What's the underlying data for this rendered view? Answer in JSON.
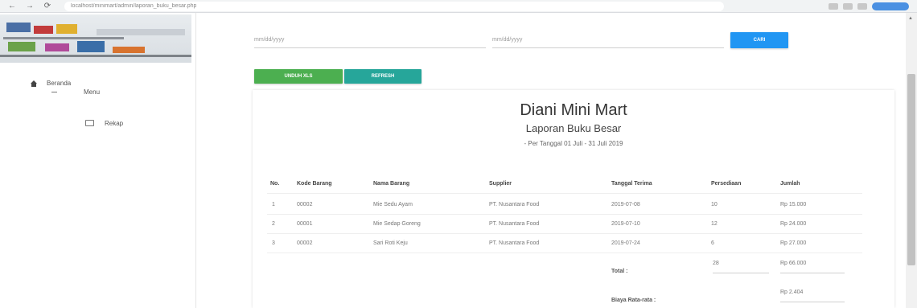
{
  "browser": {
    "back": "←",
    "forward": "→",
    "reload": "⟳",
    "url": "localhost/minimart/admin/laporan_buku_besar.php"
  },
  "sidebar": {
    "home_label": "Beranda",
    "menu_label": "Menu",
    "sub_label": "Rekap"
  },
  "filters": {
    "start_placeholder": "mm/dd/yyyy",
    "end_placeholder": "mm/dd/yyyy",
    "search_label": "CARI",
    "download_label": "UNDUH XLS",
    "refresh_label": "REFRESH"
  },
  "report": {
    "store_name": "Diani Mini Mart",
    "title": "Laporan Buku Besar",
    "period": "- Per Tanggal 01 Juli - 31 Juli 2019",
    "columns": [
      "No.",
      "Kode Barang",
      "Nama Barang",
      "Supplier",
      "Tanggal Terima",
      "Persediaan",
      "Jumlah"
    ],
    "rows": [
      [
        "1",
        "00002",
        "Mie Sedu Ayam",
        "PT. Nusantara Food",
        "2019-07-08",
        "10",
        "Rp 15.000"
      ],
      [
        "2",
        "00001",
        "Mie Sedap Goreng",
        "PT. Nusantara Food",
        "2019-07-10",
        "12",
        "Rp 24.000"
      ],
      [
        "3",
        "00002",
        "Sari Roti Keju",
        "PT. Nusantara Food",
        "2019-07-24",
        "6",
        "Rp 27.000"
      ]
    ],
    "total_label": "Total :",
    "total_qty": "28",
    "total_amount": "Rp 66.000",
    "avg_label": "Biaya Rata-rata :",
    "avg_amount": "Rp 2.404"
  },
  "colors": {
    "primary_blue": "#2196f3",
    "green": "#4caf50",
    "teal": "#26a69a"
  }
}
